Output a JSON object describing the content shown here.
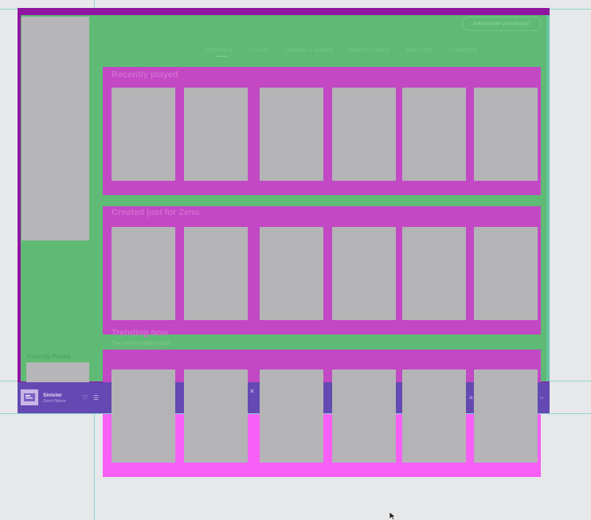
{
  "topbar": {
    "upgrade_label": "PREMIUM UPGRADE"
  },
  "nav": {
    "tabs": [
      {
        "label": "OVERVIEW",
        "active": true
      },
      {
        "label": "CHARTS",
        "active": false
      },
      {
        "label": "GENRES & MOODS",
        "active": false
      },
      {
        "label": "NEW RELEASES",
        "active": false
      },
      {
        "label": "DISCOVER",
        "active": false
      },
      {
        "label": "CONCERTS",
        "active": false
      }
    ]
  },
  "sidebar": {
    "recent_label": "Recently Played"
  },
  "sections": [
    {
      "title": "Recently played",
      "subtitle": ""
    },
    {
      "title": "Created just for Zeno",
      "subtitle": ""
    },
    {
      "title": "Trending now",
      "subtitle": "The world's hottest tracks"
    }
  ],
  "player": {
    "track_title": "Sinister",
    "artist": "Zeno Name"
  },
  "icons": {
    "like": "heart-icon",
    "queue": "queue-icon",
    "shuffle": "shuffle-icon",
    "devices": "devices-icon",
    "volume": "volume-icon"
  },
  "colors": {
    "frame": "#8f16a0",
    "main_overlay": "#5fba75",
    "section_overlay": "#c248c4",
    "card": "#b4b4b6",
    "player_bar": "#6549b3",
    "bottom_overlay": "#f75ff7",
    "guide": "#7fd6cf"
  }
}
